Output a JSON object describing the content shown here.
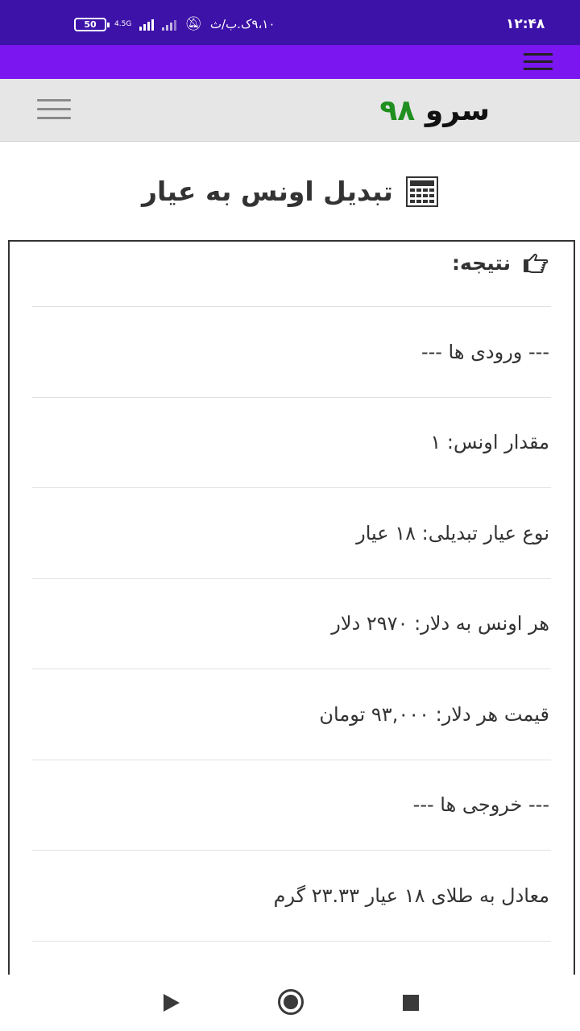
{
  "status_bar": {
    "time": "۱۲:۴۸",
    "carrier_text": "۹،۱۰ک.ب/ث",
    "battery": "50",
    "network": "4.5G"
  },
  "header": {
    "logo_word": "سرو",
    "logo_number": "۹۸",
    "logo_number_color": "#1f8f1f"
  },
  "page": {
    "title": "تبدیل اونس به عیار"
  },
  "result": {
    "heading": "نتیجه:",
    "rows": [
      "--- ورودی ها ---",
      "مقدار اونس: ۱",
      "نوع عیار تبدیلی: ۱۸ عیار",
      "هر اونس به دلار: ۲۹۷۰ دلار",
      "قیمت هر دلار: ۹۳,۰۰۰ تومان",
      "--- خروجی ها ---",
      "معادل به طلای ۱۸ عیار ۲۳.۳۳ گرم"
    ]
  },
  "colors": {
    "status_bar": "#3d12a8",
    "app_bar": "#7b16f0",
    "header_bg": "#e6e6e6"
  },
  "icons": {
    "menu": "menu-icon",
    "title": "calculator-icon",
    "result": "pointing-hand-icon"
  }
}
